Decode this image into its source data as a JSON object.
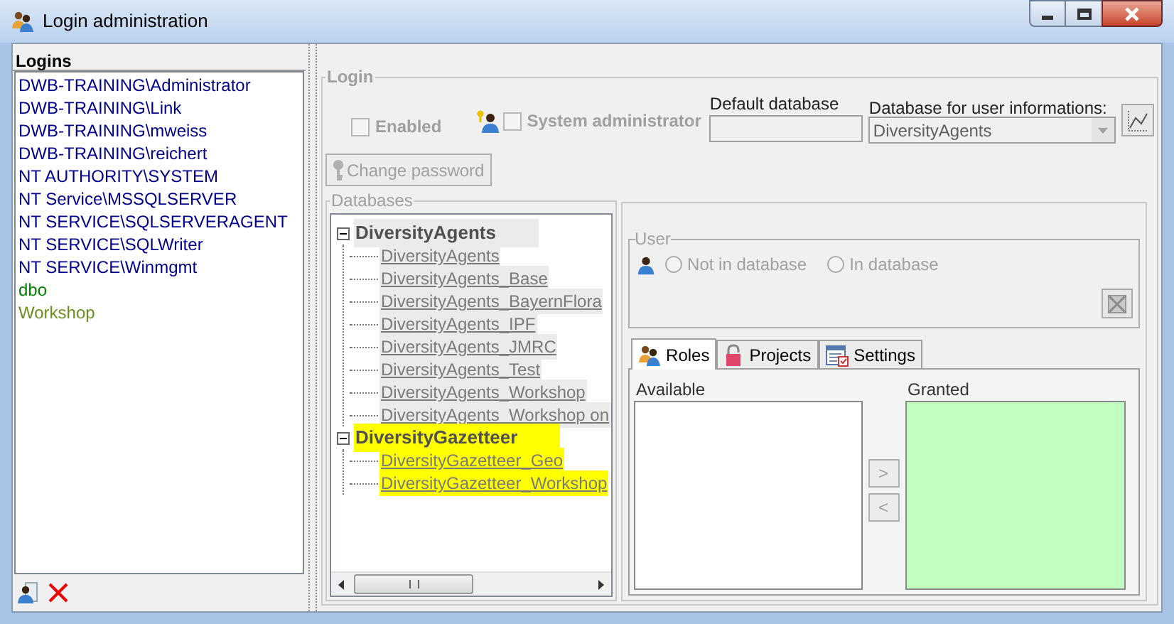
{
  "window": {
    "title": "Login administration"
  },
  "logins": {
    "header": "Logins",
    "items": [
      {
        "name": "DWB-TRAINING\\Administrator",
        "color": "#00008b"
      },
      {
        "name": "DWB-TRAINING\\Link",
        "color": "#00008b"
      },
      {
        "name": "DWB-TRAINING\\mweiss",
        "color": "#00008b"
      },
      {
        "name": "DWB-TRAINING\\reichert",
        "color": "#00008b"
      },
      {
        "name": "NT AUTHORITY\\SYSTEM",
        "color": "#00008b"
      },
      {
        "name": "NT Service\\MSSQLSERVER",
        "color": "#00008b"
      },
      {
        "name": "NT SERVICE\\SQLSERVERAGENT",
        "color": "#00008b"
      },
      {
        "name": "NT SERVICE\\SQLWriter",
        "color": "#00008b"
      },
      {
        "name": "NT SERVICE\\Winmgmt",
        "color": "#00008b"
      },
      {
        "name": "dbo",
        "color": "#008000"
      },
      {
        "name": "Workshop",
        "color": "#6b8e23"
      }
    ]
  },
  "login": {
    "legend": "Login",
    "enabled": {
      "label": "Enabled",
      "checked": false,
      "disabled": true
    },
    "system_administrator": {
      "label": "System administrator",
      "checked": false,
      "disabled": true
    },
    "default_database": {
      "label": "Default database"
    },
    "user_info_database": {
      "label": "Database for user informations:",
      "value": "DiversityAgents"
    },
    "change_password": {
      "label": "Change password",
      "disabled": true
    }
  },
  "databases": {
    "legend": "Databases",
    "tree": [
      {
        "label": "DiversityAgents",
        "highlighted": false,
        "expanded": true,
        "children": [
          {
            "label": "DiversityAgents",
            "highlighted": false
          },
          {
            "label": "DiversityAgents_Base",
            "highlighted": false
          },
          {
            "label": "DiversityAgents_BayernFlora",
            "highlighted": false
          },
          {
            "label": "DiversityAgents_IPF",
            "highlighted": false
          },
          {
            "label": "DiversityAgents_JMRC",
            "highlighted": false
          },
          {
            "label": "DiversityAgents_Test",
            "highlighted": false
          },
          {
            "label": "DiversityAgents_Workshop",
            "highlighted": false
          },
          {
            "label": "DiversityAgents_Workshop on",
            "highlighted": false
          }
        ]
      },
      {
        "label": "DiversityGazetteer",
        "highlighted": true,
        "expanded": true,
        "children": [
          {
            "label": "DiversityGazetteer_Geo",
            "highlighted": true
          },
          {
            "label": "DiversityGazetteer_Workshop",
            "highlighted": true
          }
        ]
      }
    ]
  },
  "user": {
    "legend": "User",
    "options": [
      {
        "label": "Not in database",
        "selected": false
      },
      {
        "label": "In database",
        "selected": false
      }
    ]
  },
  "tabs": [
    {
      "label": "Roles",
      "selected": true,
      "kind": "roles"
    },
    {
      "label": "Projects",
      "selected": false,
      "kind": "projects"
    },
    {
      "label": "Settings",
      "selected": false,
      "kind": "settings"
    }
  ],
  "roles": {
    "available": "Available",
    "granted": "Granted",
    "add": ">",
    "remove": "<"
  }
}
